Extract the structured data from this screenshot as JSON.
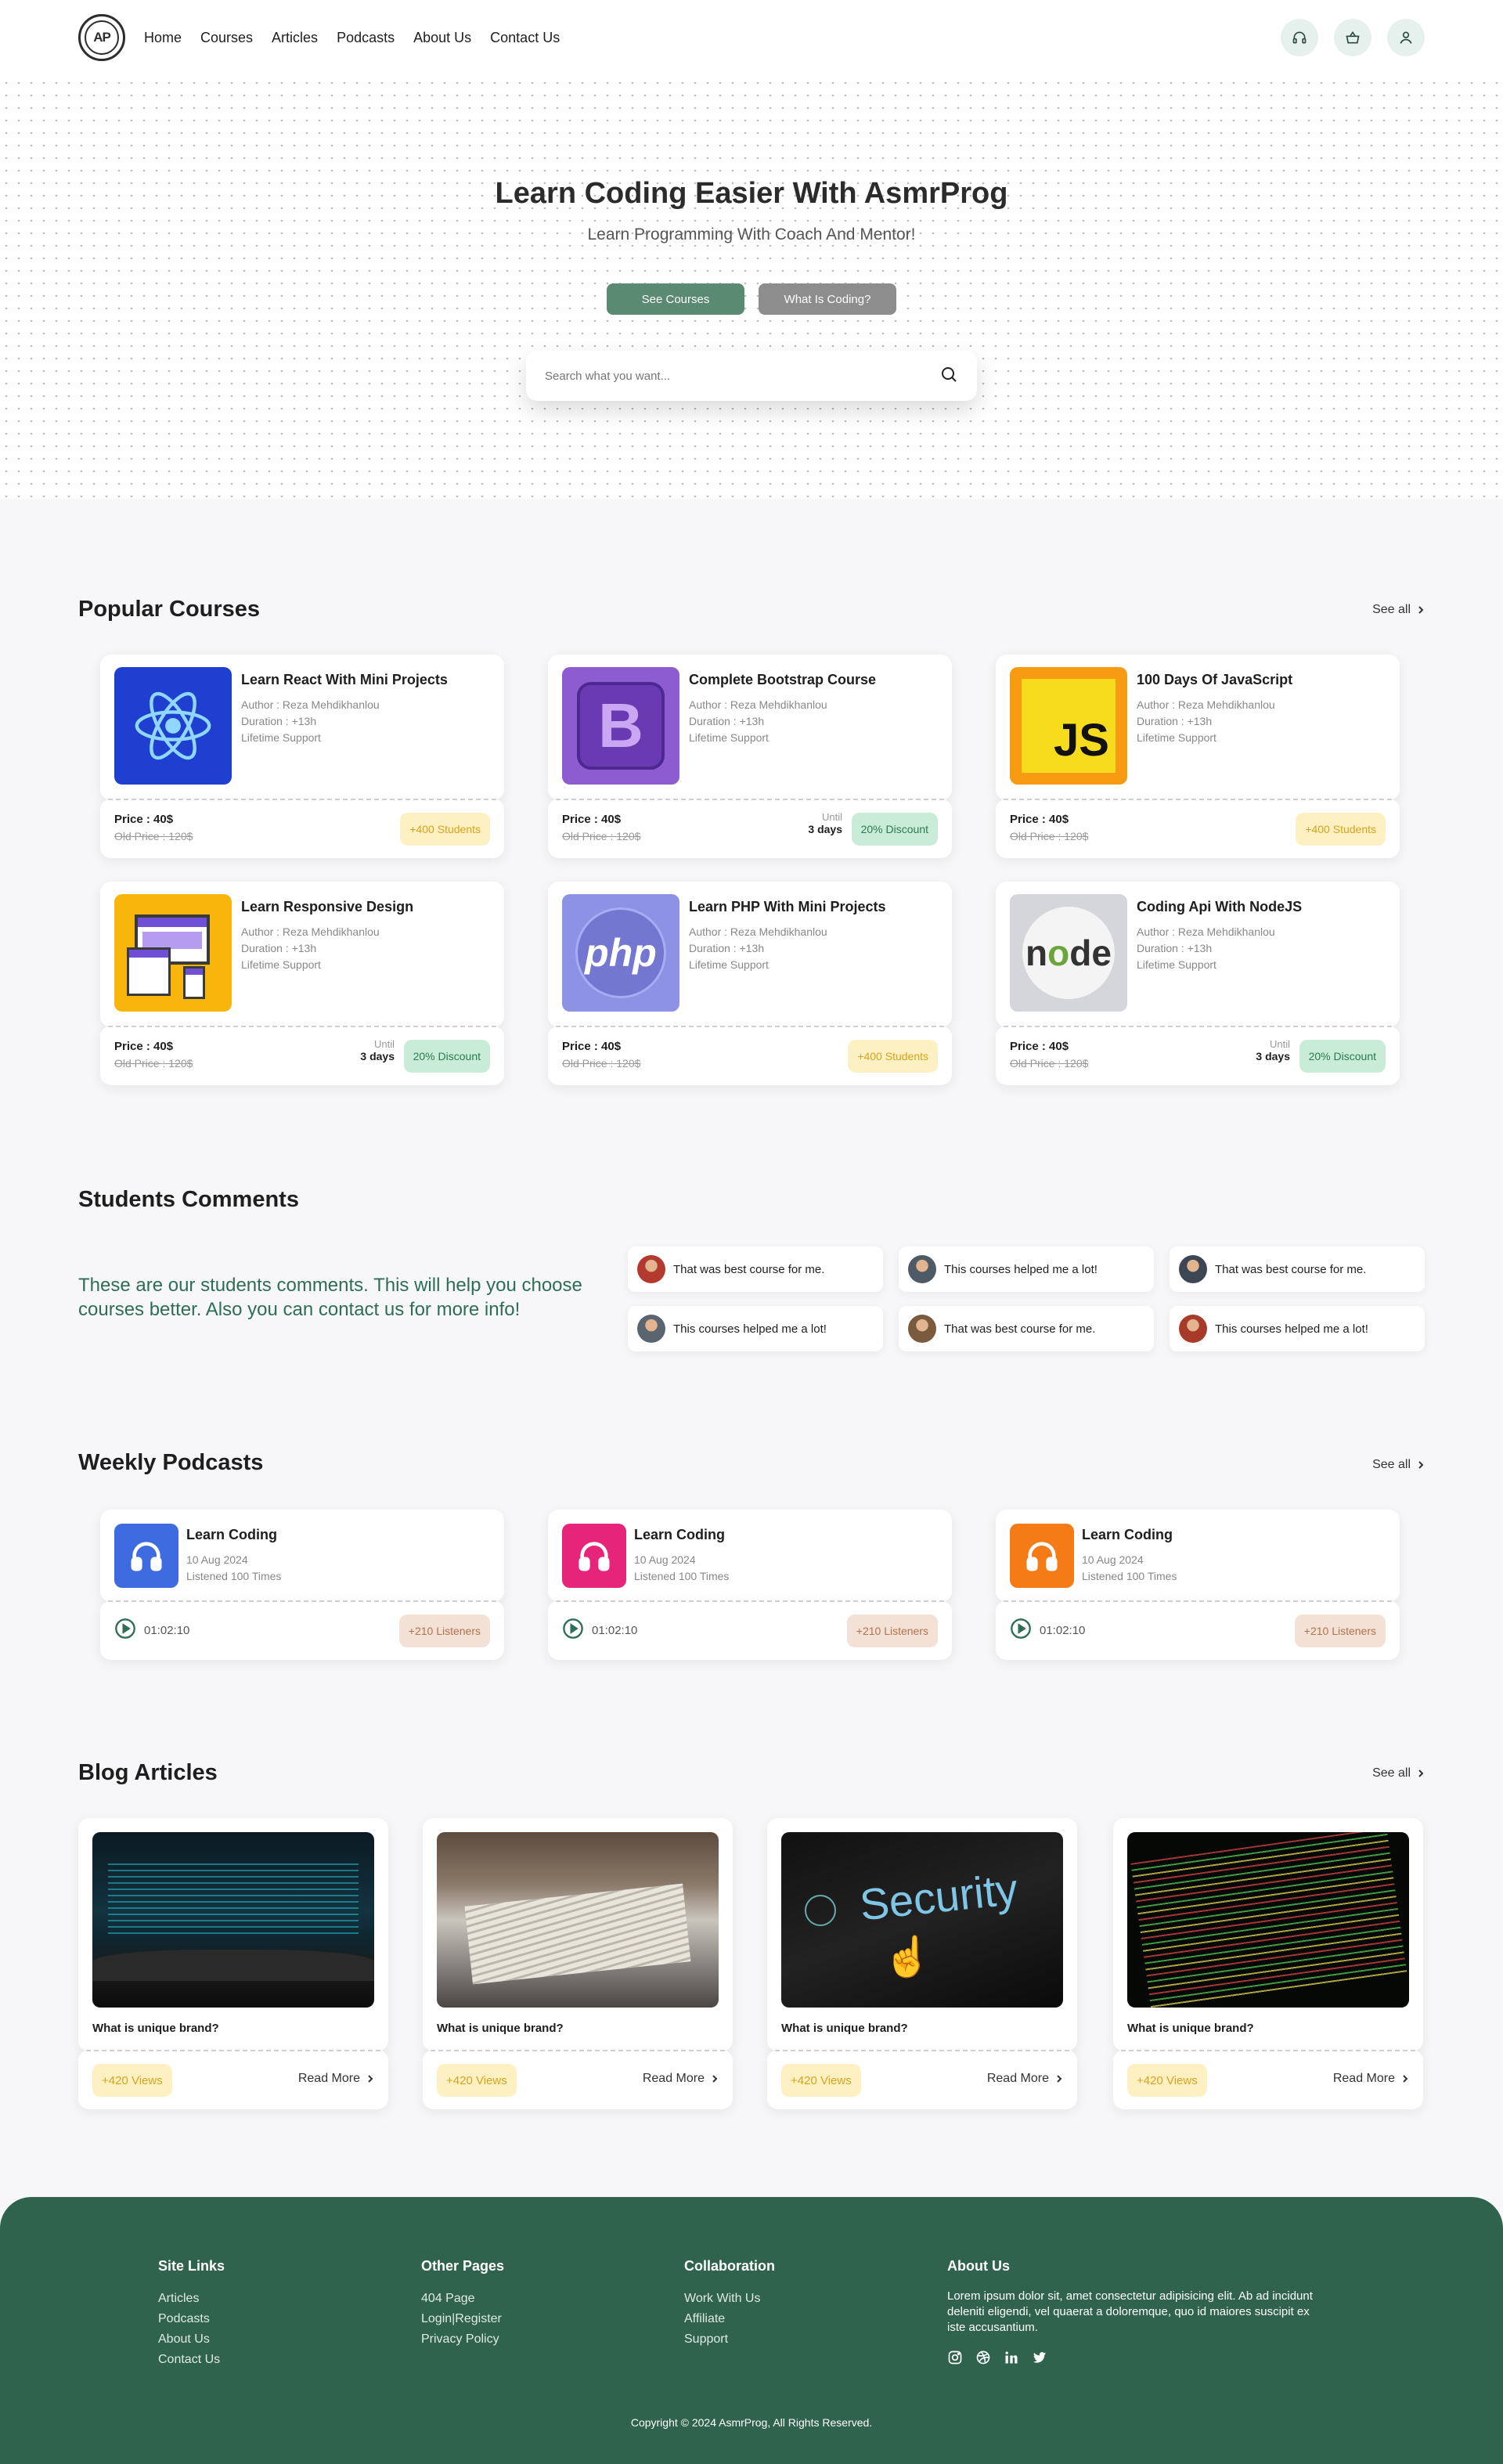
{
  "nav": [
    "Home",
    "Courses",
    "Articles",
    "Podcasts",
    "About Us",
    "Contact Us"
  ],
  "logo_text": "AP",
  "hero": {
    "title": "Learn Coding Easier With AsmrProg",
    "subtitle": "Learn Programming With Coach And Mentor!",
    "btn_primary": "See Courses",
    "btn_secondary": "What Is Coding?",
    "search_placeholder": "Search what you want..."
  },
  "popular": {
    "title": "Popular Courses",
    "see_all": "See all",
    "price_label": "Price : 40$",
    "old_price_label": "Old Price : 120$",
    "until_label": "Until",
    "until_value": "3 days",
    "courses": [
      {
        "title": "Learn React With Mini Projects",
        "author": "Author : Reza Mehdikhanlou",
        "duration": "Duration : +13h",
        "support": "Lifetime Support",
        "badge": "+400 Students",
        "badge_type": "yellow",
        "img": "react"
      },
      {
        "title": "Complete Bootstrap Course",
        "author": "Author : Reza Mehdikhanlou",
        "duration": "Duration : +13h",
        "support": "Lifetime Support",
        "badge": "20% Discount",
        "badge_type": "green",
        "img": "bootstrap"
      },
      {
        "title": "100 Days Of JavaScript",
        "author": "Author : Reza Mehdikhanlou",
        "duration": "Duration : +13h",
        "support": "Lifetime Support",
        "badge": "+400 Students",
        "badge_type": "yellow",
        "img": "js"
      },
      {
        "title": "Learn Responsive Design",
        "author": "Author : Reza Mehdikhanlou",
        "duration": "Duration : +13h",
        "support": "Lifetime Support",
        "badge": "20% Discount",
        "badge_type": "green",
        "img": "responsive"
      },
      {
        "title": "Learn PHP With Mini Projects",
        "author": "Author : Reza Mehdikhanlou",
        "duration": "Duration : +13h",
        "support": "Lifetime Support",
        "badge": "+400 Students",
        "badge_type": "yellow",
        "img": "php"
      },
      {
        "title": "Coding Api With NodeJS",
        "author": "Author : Reza Mehdikhanlou",
        "duration": "Duration : +13h",
        "support": "Lifetime Support",
        "badge": "20% Discount",
        "badge_type": "green",
        "img": "node"
      }
    ]
  },
  "comments": {
    "title": "Students Comments",
    "intro": "These are our students comments. This will help you choose courses better. Also you can contact us for more info!",
    "items": [
      "That was best course for me.",
      "This courses helped me a lot!",
      "That was best course for me.",
      "This courses helped me a lot!",
      "That was best course for me.",
      "This courses helped me a lot!"
    ]
  },
  "podcasts": {
    "title": "Weekly Podcasts",
    "see_all": "See all",
    "items": [
      {
        "title": "Learn Coding",
        "date": "10 Aug 2024",
        "listened": "Listened 100 Times",
        "duration": "01:02:10",
        "listeners": "+210 Listeners",
        "color": "#3f6be0"
      },
      {
        "title": "Learn Coding",
        "date": "10 Aug 2024",
        "listened": "Listened 100 Times",
        "duration": "01:02:10",
        "listeners": "+210 Listeners",
        "color": "#e6247a"
      },
      {
        "title": "Learn Coding",
        "date": "10 Aug 2024",
        "listened": "Listened 100 Times",
        "duration": "01:02:10",
        "listeners": "+210 Listeners",
        "color": "#f47b16"
      }
    ]
  },
  "blog": {
    "title": "Blog Articles",
    "see_all": "See all",
    "items": [
      {
        "title": "What is unique brand?",
        "views": "+420 Views",
        "read_more": "Read More",
        "img": "code-screen"
      },
      {
        "title": "What is unique brand?",
        "views": "+420 Views",
        "read_more": "Read More",
        "img": "newspapers"
      },
      {
        "title": "What is unique brand?",
        "views": "+420 Views",
        "read_more": "Read More",
        "img": "security",
        "img_text": "Security"
      },
      {
        "title": "What is unique brand?",
        "views": "+420 Views",
        "read_more": "Read More",
        "img": "code-dark"
      }
    ]
  },
  "footer": {
    "site_links": {
      "title": "Site Links",
      "items": [
        "Articles",
        "Podcasts",
        "About Us",
        "Contact Us"
      ]
    },
    "other_pages": {
      "title": "Other Pages",
      "items": [
        "404 Page",
        "Login|Register",
        "Privacy Policy"
      ]
    },
    "collaboration": {
      "title": "Collaboration",
      "items": [
        "Work With Us",
        "Affiliate",
        "Support"
      ]
    },
    "about": {
      "title": "About Us",
      "text": "Lorem ipsum dolor sit, amet consectetur adipisicing elit. Ab ad incidunt deleniti eligendi, vel quaerat a doloremque, quo id maiores suscipit ex iste accusantium."
    },
    "copyright": "Copyright © 2024 AsmrProg, All Rights Reserved."
  },
  "colors": {
    "accent": "#5a8a72",
    "footer": "#2f634e",
    "text_green": "#2f6e55"
  }
}
